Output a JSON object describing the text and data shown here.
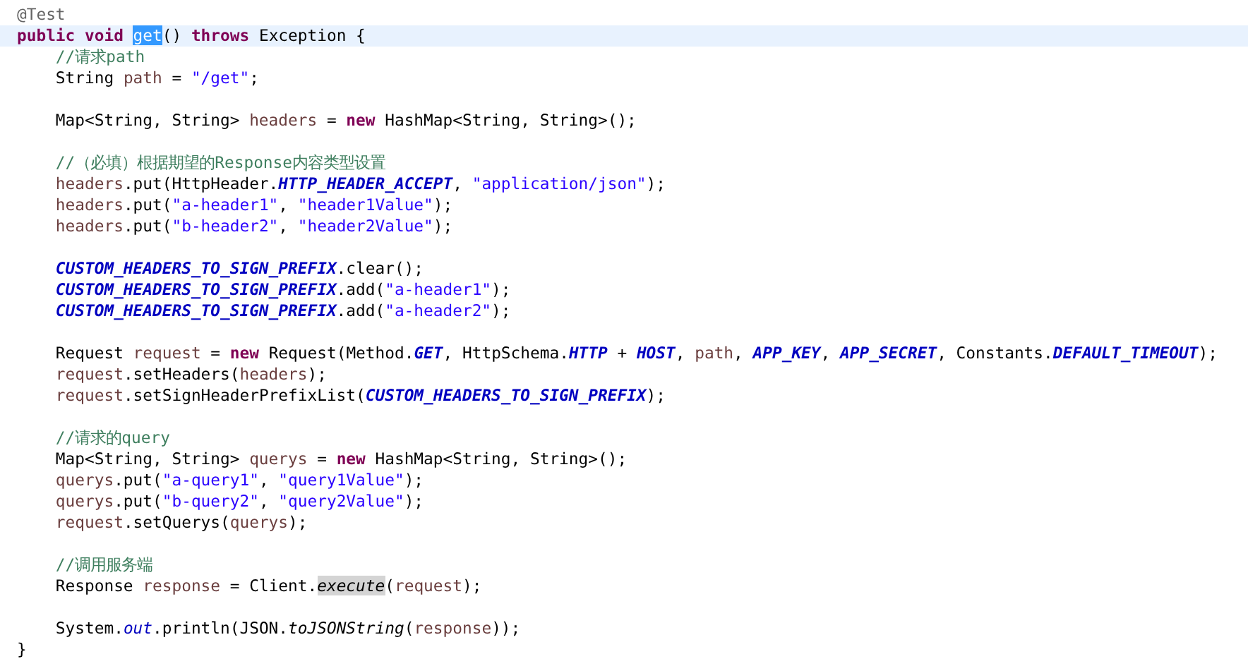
{
  "editor": {
    "lines": [
      {
        "current": false,
        "indented": false,
        "tokens": [
          {
            "kind": "annotation",
            "text": "@Test"
          }
        ]
      },
      {
        "current": true,
        "indented": false,
        "tokens": [
          {
            "kind": "keyword",
            "text": "public void "
          },
          {
            "kind": "selected-text",
            "text": "get"
          },
          {
            "kind": "plain",
            "text": "() "
          },
          {
            "kind": "keyword",
            "text": "throws"
          },
          {
            "kind": "plain",
            "text": " Exception {"
          }
        ]
      },
      {
        "current": false,
        "indented": true,
        "tokens": [
          {
            "kind": "comment",
            "text": "//请求path"
          }
        ]
      },
      {
        "current": false,
        "indented": true,
        "tokens": [
          {
            "kind": "plain",
            "text": "String "
          },
          {
            "kind": "local",
            "text": "path"
          },
          {
            "kind": "plain",
            "text": " = "
          },
          {
            "kind": "string",
            "text": "\"/get\""
          },
          {
            "kind": "plain",
            "text": ";"
          }
        ]
      },
      {
        "current": false
      },
      {
        "current": false,
        "indented": true,
        "tokens": [
          {
            "kind": "plain",
            "text": "Map<String, String> "
          },
          {
            "kind": "local",
            "text": "headers"
          },
          {
            "kind": "plain",
            "text": " = "
          },
          {
            "kind": "keyword",
            "text": "new"
          },
          {
            "kind": "plain",
            "text": " HashMap<String, String>();"
          }
        ]
      },
      {
        "current": false
      },
      {
        "current": false,
        "indented": true,
        "tokens": [
          {
            "kind": "comment",
            "text": "//（必填）根据期望的Response内容类型设置"
          }
        ]
      },
      {
        "current": false,
        "indented": true,
        "tokens": [
          {
            "kind": "local",
            "text": "headers"
          },
          {
            "kind": "plain",
            "text": ".put(HttpHeader."
          },
          {
            "kind": "constant",
            "text": "HTTP_HEADER_ACCEPT"
          },
          {
            "kind": "plain",
            "text": ", "
          },
          {
            "kind": "string",
            "text": "\"application/json\""
          },
          {
            "kind": "plain",
            "text": ");"
          }
        ]
      },
      {
        "current": false,
        "indented": true,
        "tokens": [
          {
            "kind": "local",
            "text": "headers"
          },
          {
            "kind": "plain",
            "text": ".put("
          },
          {
            "kind": "string",
            "text": "\"a-header1\""
          },
          {
            "kind": "plain",
            "text": ", "
          },
          {
            "kind": "string",
            "text": "\"header1Value\""
          },
          {
            "kind": "plain",
            "text": ");"
          }
        ]
      },
      {
        "current": false,
        "indented": true,
        "tokens": [
          {
            "kind": "local",
            "text": "headers"
          },
          {
            "kind": "plain",
            "text": ".put("
          },
          {
            "kind": "string",
            "text": "\"b-header2\""
          },
          {
            "kind": "plain",
            "text": ", "
          },
          {
            "kind": "string",
            "text": "\"header2Value\""
          },
          {
            "kind": "plain",
            "text": ");"
          }
        ]
      },
      {
        "current": false
      },
      {
        "current": false,
        "indented": true,
        "tokens": [
          {
            "kind": "constant",
            "text": "CUSTOM_HEADERS_TO_SIGN_PREFIX"
          },
          {
            "kind": "plain",
            "text": ".clear();"
          }
        ]
      },
      {
        "current": false,
        "indented": true,
        "tokens": [
          {
            "kind": "constant",
            "text": "CUSTOM_HEADERS_TO_SIGN_PREFIX"
          },
          {
            "kind": "plain",
            "text": ".add("
          },
          {
            "kind": "string",
            "text": "\"a-header1\""
          },
          {
            "kind": "plain",
            "text": ");"
          }
        ]
      },
      {
        "current": false,
        "indented": true,
        "tokens": [
          {
            "kind": "constant",
            "text": "CUSTOM_HEADERS_TO_SIGN_PREFIX"
          },
          {
            "kind": "plain",
            "text": ".add("
          },
          {
            "kind": "string",
            "text": "\"a-header2\""
          },
          {
            "kind": "plain",
            "text": ");"
          }
        ]
      },
      {
        "current": false
      },
      {
        "current": false,
        "indented": true,
        "tokens": [
          {
            "kind": "plain",
            "text": "Request "
          },
          {
            "kind": "local",
            "text": "request"
          },
          {
            "kind": "plain",
            "text": " = "
          },
          {
            "kind": "keyword",
            "text": "new"
          },
          {
            "kind": "plain",
            "text": " Request(Method."
          },
          {
            "kind": "constant",
            "text": "GET"
          },
          {
            "kind": "plain",
            "text": ", HttpSchema."
          },
          {
            "kind": "constant",
            "text": "HTTP"
          },
          {
            "kind": "plain",
            "text": " + "
          },
          {
            "kind": "constant",
            "text": "HOST"
          },
          {
            "kind": "plain",
            "text": ", "
          },
          {
            "kind": "local",
            "text": "path"
          },
          {
            "kind": "plain",
            "text": ", "
          },
          {
            "kind": "constant",
            "text": "APP_KEY"
          },
          {
            "kind": "plain",
            "text": ", "
          },
          {
            "kind": "constant",
            "text": "APP_SECRET"
          },
          {
            "kind": "plain",
            "text": ", Constants."
          },
          {
            "kind": "constant",
            "text": "DEFAULT_TIMEOUT"
          },
          {
            "kind": "plain",
            "text": ");"
          }
        ]
      },
      {
        "current": false,
        "indented": true,
        "tokens": [
          {
            "kind": "local",
            "text": "request"
          },
          {
            "kind": "plain",
            "text": ".setHeaders("
          },
          {
            "kind": "local",
            "text": "headers"
          },
          {
            "kind": "plain",
            "text": ");"
          }
        ]
      },
      {
        "current": false,
        "indented": true,
        "tokens": [
          {
            "kind": "local",
            "text": "request"
          },
          {
            "kind": "plain",
            "text": ".setSignHeaderPrefixList("
          },
          {
            "kind": "constant",
            "text": "CUSTOM_HEADERS_TO_SIGN_PREFIX"
          },
          {
            "kind": "plain",
            "text": ");"
          }
        ]
      },
      {
        "current": false
      },
      {
        "current": false,
        "indented": true,
        "tokens": [
          {
            "kind": "comment",
            "text": "//请求的query"
          }
        ]
      },
      {
        "current": false,
        "indented": true,
        "tokens": [
          {
            "kind": "plain",
            "text": "Map<String, String> "
          },
          {
            "kind": "local",
            "text": "querys"
          },
          {
            "kind": "plain",
            "text": " = "
          },
          {
            "kind": "keyword",
            "text": "new"
          },
          {
            "kind": "plain",
            "text": " HashMap<String, String>();"
          }
        ]
      },
      {
        "current": false,
        "indented": true,
        "tokens": [
          {
            "kind": "local",
            "text": "querys"
          },
          {
            "kind": "plain",
            "text": ".put("
          },
          {
            "kind": "string",
            "text": "\"a-query1\""
          },
          {
            "kind": "plain",
            "text": ", "
          },
          {
            "kind": "string",
            "text": "\"query1Value\""
          },
          {
            "kind": "plain",
            "text": ");"
          }
        ]
      },
      {
        "current": false,
        "indented": true,
        "tokens": [
          {
            "kind": "local",
            "text": "querys"
          },
          {
            "kind": "plain",
            "text": ".put("
          },
          {
            "kind": "string",
            "text": "\"b-query2\""
          },
          {
            "kind": "plain",
            "text": ", "
          },
          {
            "kind": "string",
            "text": "\"query2Value\""
          },
          {
            "kind": "plain",
            "text": ");"
          }
        ]
      },
      {
        "current": false,
        "indented": true,
        "tokens": [
          {
            "kind": "local",
            "text": "request"
          },
          {
            "kind": "plain",
            "text": ".setQuerys("
          },
          {
            "kind": "local",
            "text": "querys"
          },
          {
            "kind": "plain",
            "text": ");"
          }
        ]
      },
      {
        "current": false
      },
      {
        "current": false,
        "indented": true,
        "tokens": [
          {
            "kind": "comment",
            "text": "//调用服务端"
          }
        ]
      },
      {
        "current": false,
        "indented": true,
        "tokens": [
          {
            "kind": "plain",
            "text": "Response "
          },
          {
            "kind": "local",
            "text": "response"
          },
          {
            "kind": "plain",
            "text": " = Client."
          },
          {
            "kind": "occurrence-static-method",
            "text": "execute"
          },
          {
            "kind": "plain",
            "text": "("
          },
          {
            "kind": "local",
            "text": "request"
          },
          {
            "kind": "plain",
            "text": ");"
          }
        ]
      },
      {
        "current": false
      },
      {
        "current": false,
        "indented": true,
        "tokens": [
          {
            "kind": "plain",
            "text": "System."
          },
          {
            "kind": "static-field",
            "text": "out"
          },
          {
            "kind": "plain",
            "text": ".println(JSON."
          },
          {
            "kind": "static-method",
            "text": "toJSONString"
          },
          {
            "kind": "plain",
            "text": "("
          },
          {
            "kind": "local",
            "text": "response"
          },
          {
            "kind": "plain",
            "text": "));"
          }
        ]
      },
      {
        "current": false,
        "indented": false,
        "tokens": [
          {
            "kind": "plain",
            "text": "}"
          }
        ]
      }
    ]
  }
}
